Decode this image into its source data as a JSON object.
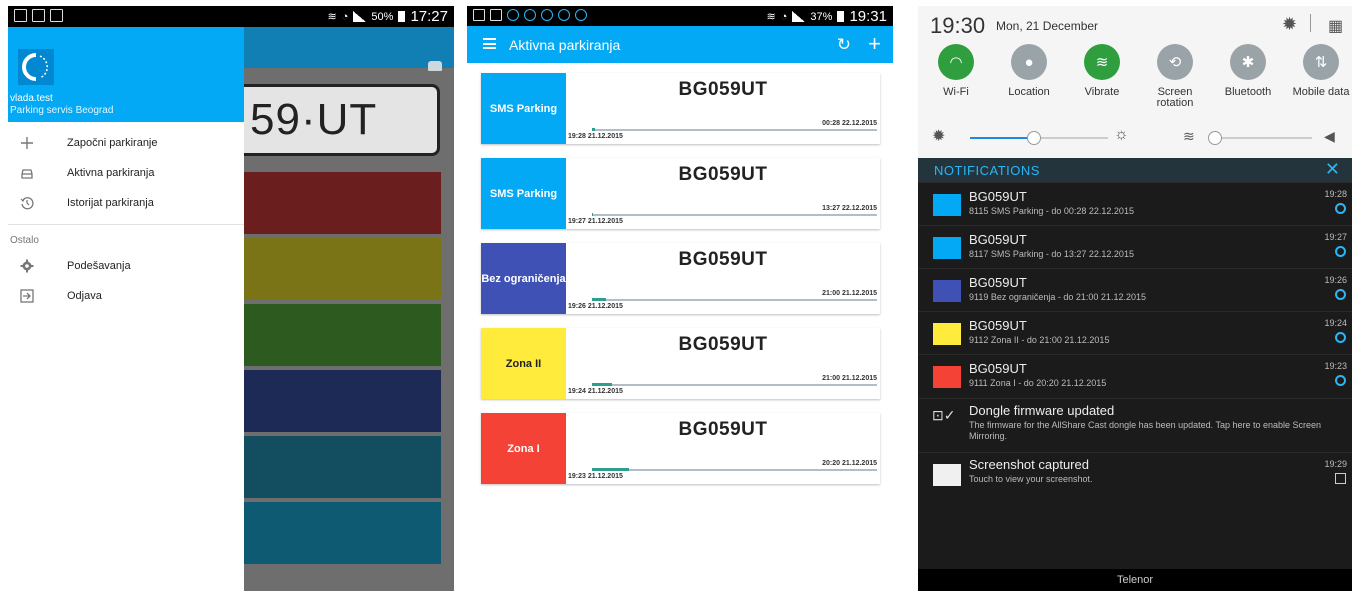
{
  "screen1": {
    "status_bar": {
      "battery": "50%",
      "time": "17:27"
    },
    "background": {
      "plate_text": "59·UT",
      "tiles": [
        "#6b1e1e",
        "#7a7416",
        "#2d5a1f",
        "#1c2a55",
        "#124e60",
        "#0f5a73"
      ]
    },
    "drawer": {
      "username": "vlada.test",
      "company": "Parking servis Beograd",
      "primary_items": [
        {
          "label": "Započni parkiranje",
          "icon": "plus-icon"
        },
        {
          "label": "Aktivna parkiranja",
          "icon": "car-icon"
        },
        {
          "label": "Istorijat parkiranja",
          "icon": "history-icon"
        }
      ],
      "section_label": "Ostalo",
      "secondary_items": [
        {
          "label": "Podešavanja",
          "icon": "gear-icon"
        },
        {
          "label": "Odjava",
          "icon": "logout-icon"
        }
      ]
    }
  },
  "screen2": {
    "status_bar": {
      "battery": "37%",
      "time": "19:31"
    },
    "app_bar": {
      "title": "Aktivna parkiranja"
    },
    "cards": [
      {
        "zone": "SMS Parking",
        "color": "#03a9f4",
        "plate": "BG059UT",
        "start": "19:28 21.12.2015",
        "end": "00:28 22.12.2015",
        "progress": 0.01
      },
      {
        "zone": "SMS Parking",
        "color": "#03a9f4",
        "plate": "BG059UT",
        "start": "19:27 21.12.2015",
        "end": "13:27 22.12.2015",
        "progress": 0.0
      },
      {
        "zone": "Bez ograničenja",
        "color": "#3f51b5",
        "plate": "BG059UT",
        "start": "19:26 21.12.2015",
        "end": "21:00 21.12.2015",
        "progress": 0.05
      },
      {
        "zone": "Zona II",
        "color": "#ffeb3b",
        "zone_text_color": "#222222",
        "plate": "BG059UT",
        "start": "19:24 21.12.2015",
        "end": "21:00 21.12.2015",
        "progress": 0.07
      },
      {
        "zone": "Zona I",
        "color": "#f44336",
        "plate": "BG059UT",
        "start": "19:23 21.12.2015",
        "end": "20:20 21.12.2015",
        "progress": 0.13
      }
    ]
  },
  "screen3": {
    "clock": "19:30",
    "date": "Mon, 21 December",
    "quick_settings": [
      {
        "label": "Wi-Fi",
        "icon": "wifi-icon",
        "active": true
      },
      {
        "label": "Location",
        "icon": "location-icon",
        "active": false
      },
      {
        "label": "Vibrate",
        "icon": "vibrate-icon",
        "active": true
      },
      {
        "label": "Screen rotation",
        "icon": "rotation-icon",
        "active": false
      },
      {
        "label": "Bluetooth",
        "icon": "bluetooth-icon",
        "active": false
      },
      {
        "label": "Mobile data",
        "icon": "mobile-data-icon",
        "active": false
      }
    ],
    "notifications_title": "NOTIFICATIONS",
    "notifications": [
      {
        "title": "BG059UT",
        "desc": "8115 SMS Parking - do 00:28 22.12.2015",
        "time": "19:28",
        "color": "#03a9f4"
      },
      {
        "title": "BG059UT",
        "desc": "8117 SMS Parking - do 13:27 22.12.2015",
        "time": "19:27",
        "color": "#03a9f4"
      },
      {
        "title": "BG059UT",
        "desc": "9119 Bez ograničenja - do 21:00 21.12.2015",
        "time": "19:26",
        "color": "#3f51b5"
      },
      {
        "title": "BG059UT",
        "desc": "9112 Zona II - do 21:00 21.12.2015",
        "time": "19:24",
        "color": "#ffeb3b"
      },
      {
        "title": "BG059UT",
        "desc": "9111 Zona I - do 20:20 21.12.2015",
        "time": "19:23",
        "color": "#f44336"
      }
    ],
    "dongle": {
      "title": "Dongle firmware updated",
      "desc": "The firmware for the AllShare Cast dongle has been updated. Tap here to enable Screen Mirroring."
    },
    "screenshot": {
      "title": "Screenshot captured",
      "desc": "Touch to view your screenshot.",
      "time": "19:29"
    },
    "carrier": "Telenor"
  }
}
